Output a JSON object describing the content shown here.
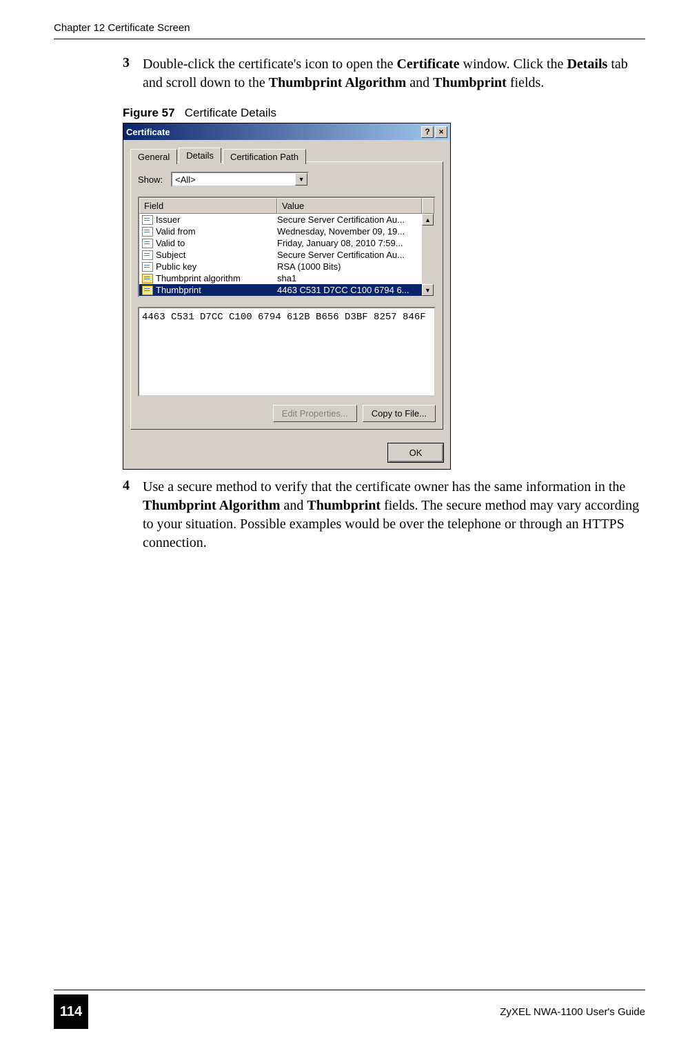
{
  "header": {
    "chapter": "Chapter 12 Certificate Screen"
  },
  "steps": {
    "step3": {
      "num": "3",
      "text_parts": {
        "p1": "Double-click the certificate's icon to open the ",
        "b1": "Certificate",
        "p2": " window. Click the ",
        "b2": "Details",
        "p3": " tab and scroll down to the ",
        "b3": "Thumbprint Algorithm",
        "p4": " and ",
        "b4": "Thumbprint",
        "p5": " fields."
      }
    },
    "step4": {
      "num": "4",
      "text_parts": {
        "p1": "Use a secure method to verify that the certificate owner has the same information in the ",
        "b1": "Thumbprint Algorithm",
        "p2": " and ",
        "b2": "Thumbprint",
        "p3": " fields. The secure method may vary according to your situation. Possible examples would be over the telephone or through an HTTPS connection."
      }
    }
  },
  "figure": {
    "label": "Figure 57",
    "title": "Certificate Details"
  },
  "cert_window": {
    "title": "Certificate",
    "help_glyph": "?",
    "close_glyph": "×",
    "tabs": {
      "general": "General",
      "details": "Details",
      "certpath": "Certification Path"
    },
    "show_label": "Show:",
    "show_value": "<All>",
    "table": {
      "header_field": "Field",
      "header_value": "Value",
      "rows": [
        {
          "field": "Issuer",
          "value": "Secure Server Certification Au..."
        },
        {
          "field": "Valid from",
          "value": "Wednesday, November 09, 19..."
        },
        {
          "field": "Valid to",
          "value": "Friday, January 08, 2010 7:59..."
        },
        {
          "field": "Subject",
          "value": "Secure Server Certification Au..."
        },
        {
          "field": "Public key",
          "value": "RSA (1000 Bits)"
        },
        {
          "field": "Thumbprint algorithm",
          "value": "sha1"
        },
        {
          "field": "Thumbprint",
          "value": "4463 C531 D7CC C100 6794 6..."
        }
      ]
    },
    "detail_text": "4463 C531 D7CC C100 6794 612B B656 D3BF 8257 846F",
    "buttons": {
      "edit": "Edit Properties...",
      "copy": "Copy to File...",
      "ok": "OK"
    }
  },
  "footer": {
    "page": "114",
    "guide": "ZyXEL NWA-1100 User's Guide"
  }
}
